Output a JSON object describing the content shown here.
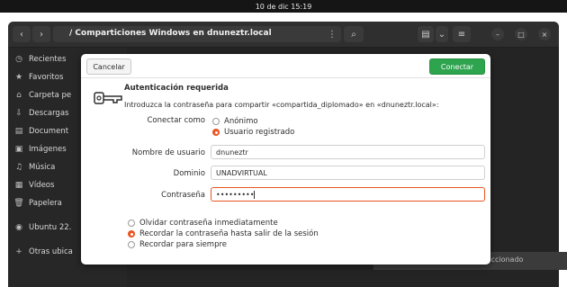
{
  "topbar": {
    "datetime": "10 de dic  15:19"
  },
  "header": {
    "back_icon": "‹",
    "forward_icon": "›",
    "path": "/  Comparticiones Windows en dnuneztr.local",
    "menu_icon": "⋮",
    "search_icon": "⌕",
    "view_icon": "▤",
    "view_dropdown_icon": "⌄",
    "hamburger_icon": "≡",
    "minimize_icon": "–",
    "maximize_icon": "□",
    "close_icon": "×"
  },
  "sidebar": {
    "items": [
      {
        "label": "Recientes",
        "icon": "◷"
      },
      {
        "label": "Favoritos",
        "icon": "★"
      },
      {
        "label": "Carpeta pe",
        "icon": "⌂"
      },
      {
        "label": "Descargas",
        "icon": "⇩"
      },
      {
        "label": "Document",
        "icon": "▤"
      },
      {
        "label": "Imágenes",
        "icon": "▣"
      },
      {
        "label": "Música",
        "icon": "♫"
      },
      {
        "label": "Vídeos",
        "icon": "▦"
      },
      {
        "label": "Papelera",
        "icon": "🗑"
      },
      {
        "label": "Ubuntu 22.",
        "icon": "◉"
      },
      {
        "label": "Otras ubica",
        "icon": "+"
      }
    ]
  },
  "status": {
    "text": "«Compartida_Diplomado» seleccionado"
  },
  "dialog": {
    "cancel_label": "Cancelar",
    "connect_label": "Conectar",
    "title": "Autenticación requerida",
    "message": "Introduzca la contraseña para compartir «compartida_diplomado» en «dnuneztr.local»:",
    "connect_as_label": "Conectar como",
    "connect_as_options": [
      "Anónimo",
      "Usuario registrado"
    ],
    "username_label": "Nombre de usuario",
    "username_value": "dnuneztr",
    "domain_label": "Dominio",
    "domain_value": "UNADVIRTUAL",
    "password_label": "Contraseña",
    "password_value": "•••••••••",
    "remember_options": [
      "Olvidar contraseña inmediatamente",
      "Recordar la contraseña hasta salir de la sesión",
      "Recordar para siempre"
    ]
  },
  "colors": {
    "accent": "#e95420",
    "connect": "#2ea44f"
  }
}
